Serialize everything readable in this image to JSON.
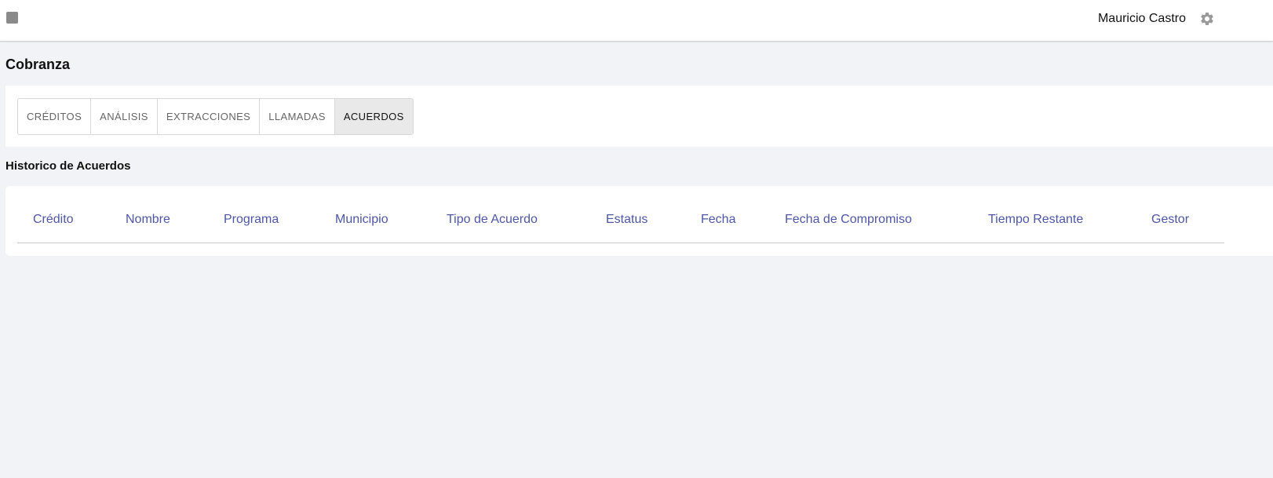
{
  "header": {
    "user_name": "Mauricio Castro",
    "icons": {
      "menu": "menu-toggle-icon",
      "settings": "gear-icon"
    }
  },
  "page": {
    "title": "Cobranza"
  },
  "tabs": [
    {
      "label": "CRÉDITOS",
      "active": false
    },
    {
      "label": "ANÁLISIS",
      "active": false
    },
    {
      "label": "EXTRACCIONES",
      "active": false
    },
    {
      "label": "LLAMADAS",
      "active": false
    },
    {
      "label": "ACUERDOS",
      "active": true
    }
  ],
  "history": {
    "title": "Historico de Acuerdos",
    "columns": [
      "Crédito",
      "Nombre",
      "Programa",
      "Municipio",
      "Tipo de Acuerdo",
      "Estatus",
      "Fecha",
      "Fecha de Compromiso",
      "Tiempo Restante",
      "Gestor"
    ],
    "rows": []
  },
  "colors": {
    "header_text": "#4e57a6",
    "background": "#f2f3f6",
    "active_tab": "#e9e9e9"
  }
}
